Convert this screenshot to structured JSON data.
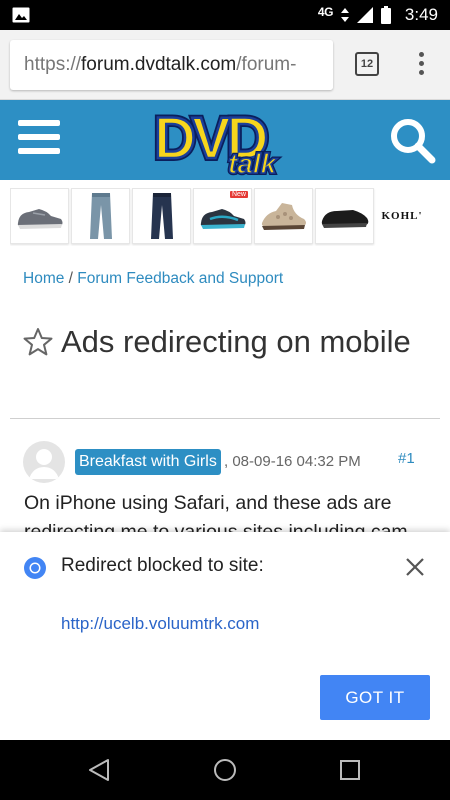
{
  "status_bar": {
    "network": "4G",
    "time": "3:49",
    "icons": [
      "image-notification-icon",
      "data-arrows-icon",
      "signal-icon",
      "battery-icon"
    ]
  },
  "browser": {
    "url_scheme": "https://",
    "url_host": "forum.dvdtalk.com",
    "url_path": "/forum-",
    "tab_count": "12"
  },
  "site_header": {
    "logo_alt": "DVD talk",
    "logo_text_main": "DVD",
    "logo_text_sub": "talk",
    "colors": {
      "header_bg": "#2d8fc4",
      "logo_yellow": "#f7d51d",
      "logo_blue": "#1b3f9a"
    }
  },
  "ad_strip": {
    "tiles": [
      {
        "name": "grey-sneaker"
      },
      {
        "name": "jeans"
      },
      {
        "name": "dark-jeans"
      },
      {
        "name": "blue-sneaker",
        "badge": "New"
      },
      {
        "name": "sandal-bootie"
      },
      {
        "name": "black-slip-on"
      }
    ],
    "brand": "KOHL'"
  },
  "breadcrumb": {
    "home": "Home",
    "separator": "/",
    "section": "Forum Feedback and Support"
  },
  "thread": {
    "title": "Ads redirecting on mobile"
  },
  "post": {
    "username": "Breakfast with Girls",
    "date": ", 08-09-16 04:32 PM",
    "number_prefix": "#",
    "number": "1",
    "body": "On iPhone using Safari, and these ads are redirecting me to various sites including cam"
  },
  "redirect_popup": {
    "title": "Redirect blocked to site:",
    "link": "http://ucelb.voluumtrk.com",
    "button": "GOT IT",
    "colors": {
      "button_bg": "#4285f4",
      "link": "#2a64c8"
    }
  },
  "nav_bar": {
    "buttons": [
      "back",
      "home",
      "recents"
    ]
  }
}
